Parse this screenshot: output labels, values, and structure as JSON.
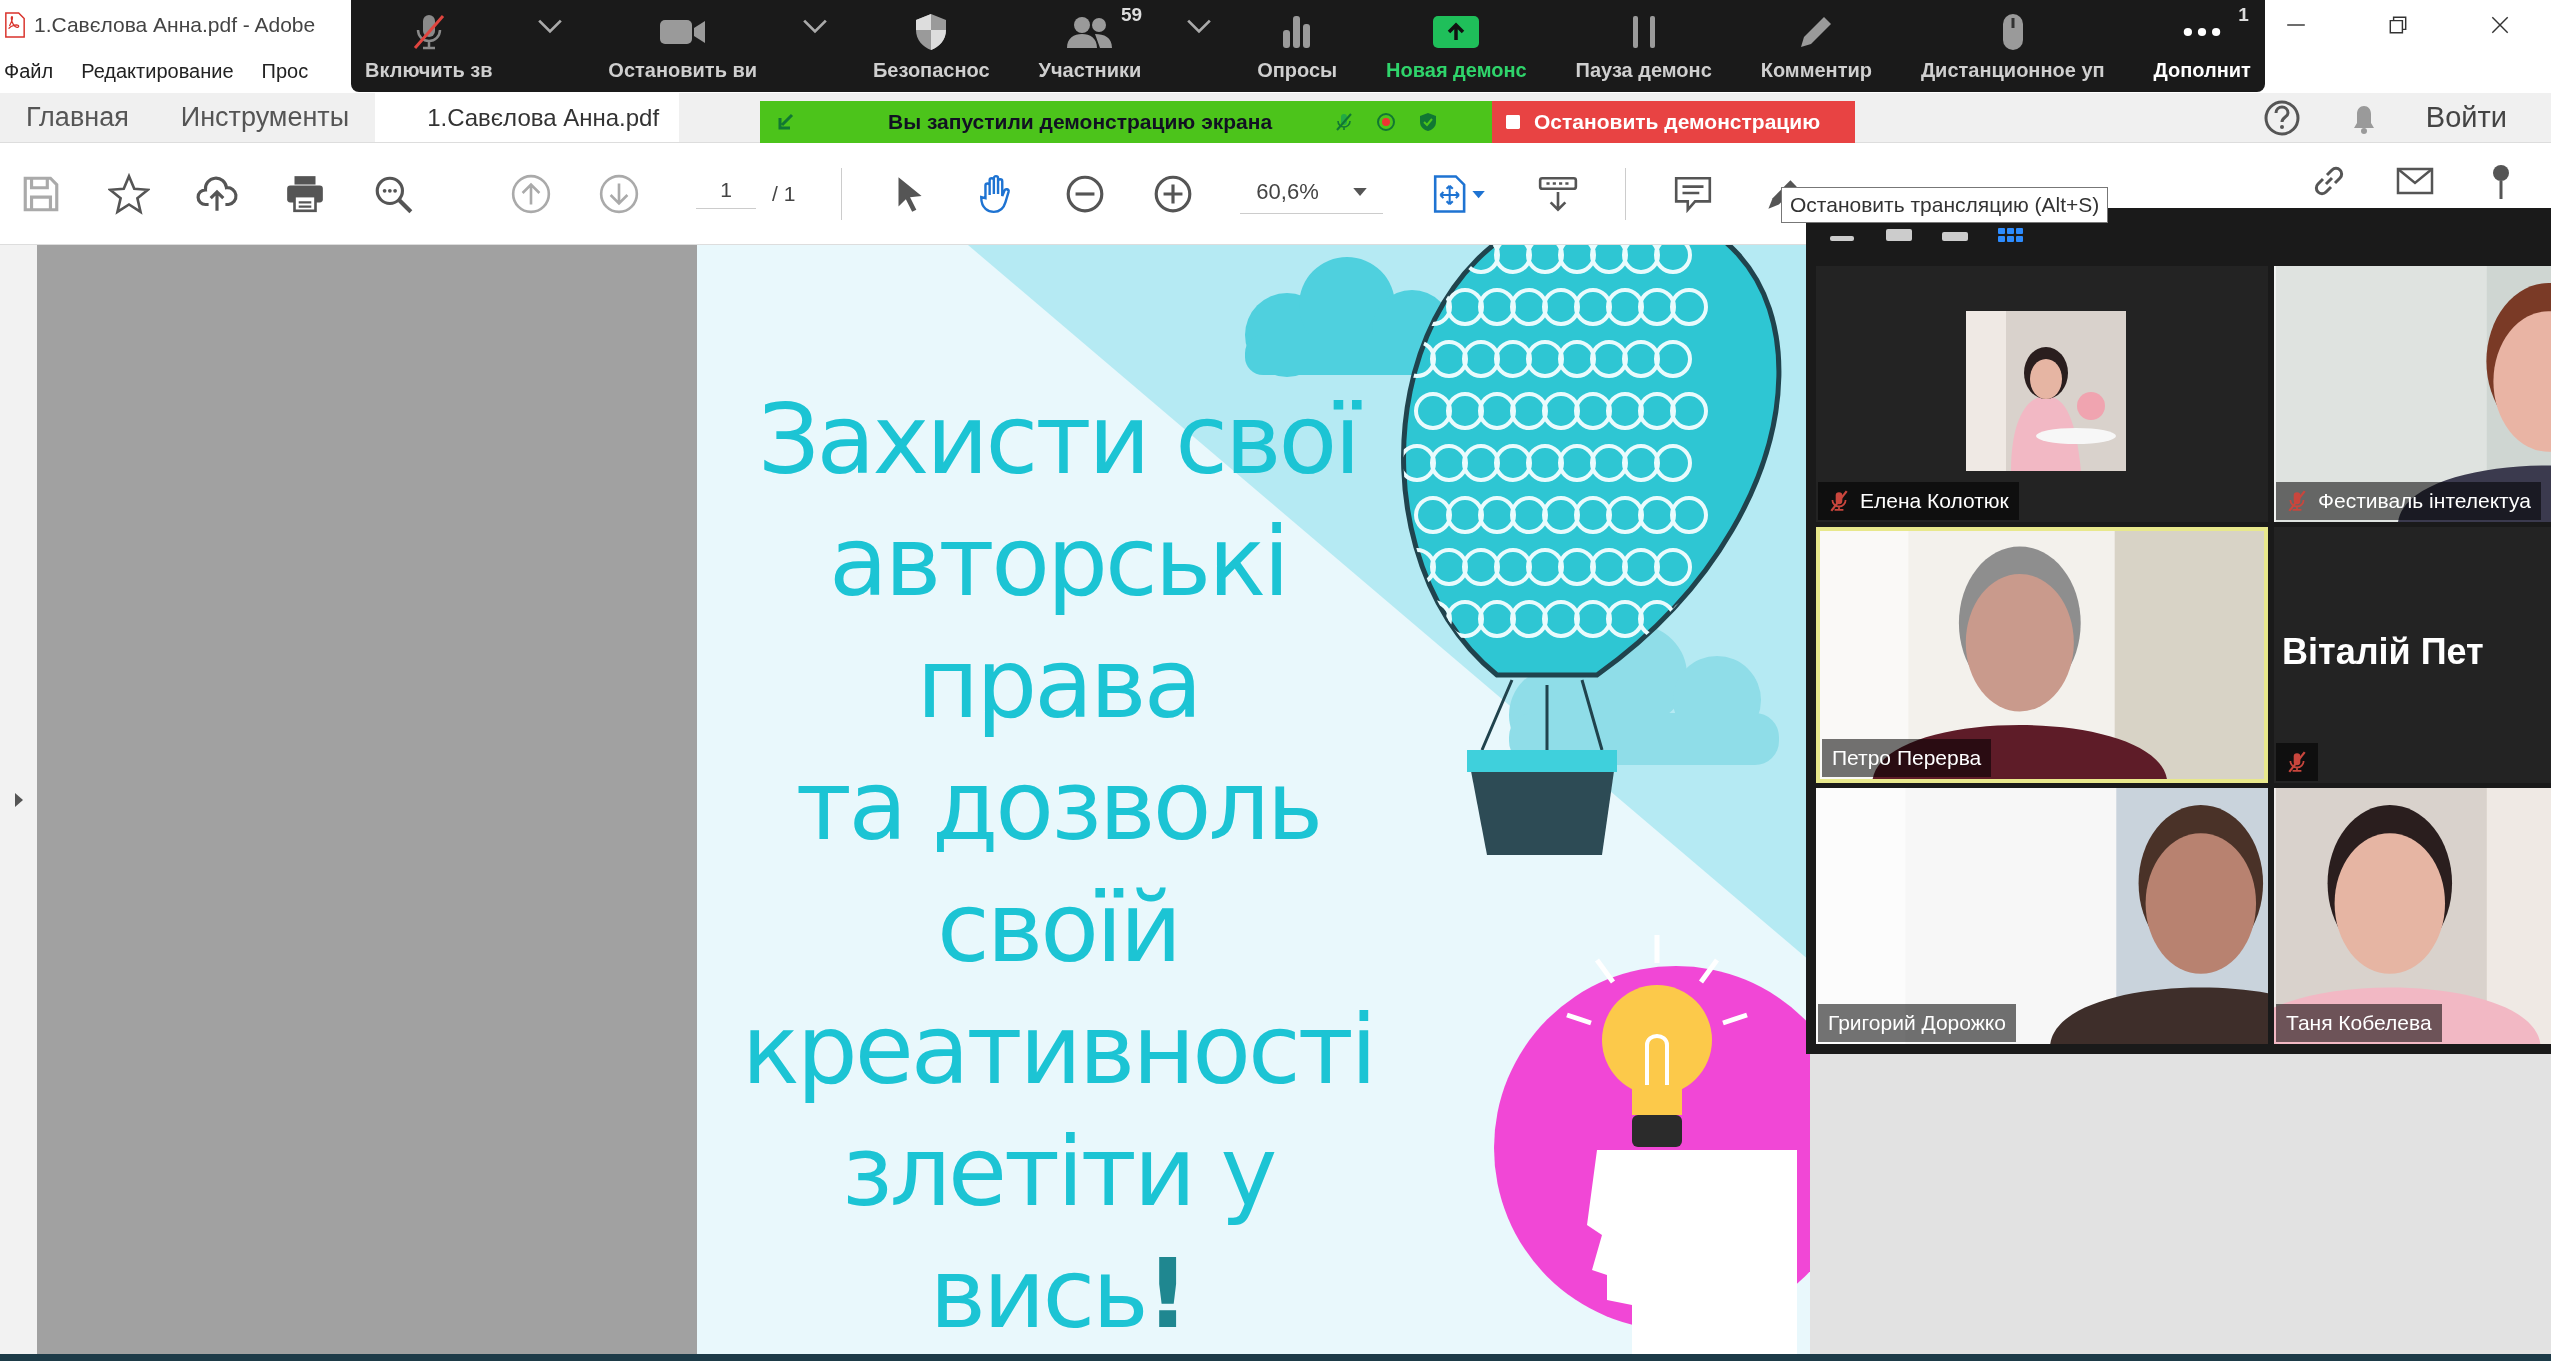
{
  "window": {
    "title": "1.Савєлова Анна.pdf - Adobe"
  },
  "menu": [
    "Файл",
    "Редактирование",
    "Прос"
  ],
  "tabs": [
    {
      "label": "Главная",
      "selected": false
    },
    {
      "label": "Инструменты",
      "selected": false
    },
    {
      "label": "1.Савєлова Анна.pdf",
      "selected": true
    }
  ],
  "header": {
    "sign_in": "Войти"
  },
  "toolbar": {
    "page": "1",
    "page_total": "/ 1",
    "zoom": "60,6%"
  },
  "document": {
    "lines": [
      "Захисти свої",
      "авторські",
      "права",
      "та дозволь",
      "своїй",
      "креативності",
      "злетіти у"
    ],
    "last_line": {
      "text": "вись",
      "accent": "!"
    }
  },
  "zoom_controls": [
    {
      "kind": "mic",
      "label": "Включить зв",
      "muted": true,
      "menu": true
    },
    {
      "kind": "video",
      "label": "Остановить ви",
      "menu": true
    },
    {
      "kind": "security",
      "label": "Безопаснос",
      "menu": false
    },
    {
      "kind": "participants",
      "label": "Участники",
      "badge": "59",
      "menu": true
    },
    {
      "kind": "polls",
      "label": "Опросы",
      "menu": false
    },
    {
      "kind": "share",
      "label": "Новая демонс",
      "menu": false
    },
    {
      "kind": "pause",
      "label": "Пауза демонс",
      "menu": false
    },
    {
      "kind": "annotate",
      "label": "Комментир",
      "menu": false
    },
    {
      "kind": "remote",
      "label": "Дистанционное уп",
      "menu": false
    },
    {
      "kind": "more",
      "label": "Дополнит",
      "badge": "1",
      "menu": false
    }
  ],
  "share_banner": {
    "message": "Вы запустили демонстрацию экрана",
    "stop": "Остановить демонстрацию"
  },
  "tooltip": "Остановить трансляцию (Alt+S)",
  "gallery": {
    "tiles": [
      {
        "name": "Елена Колотюк",
        "kind": "avatar",
        "muted": true,
        "speaking": false
      },
      {
        "name": "Фестиваль інтелектуа",
        "kind": "video",
        "muted": true,
        "speaking": false
      },
      {
        "name": "Петро Перерва",
        "kind": "video",
        "muted": false,
        "speaking": true
      },
      {
        "name": "Віталій Пет",
        "kind": "name",
        "muted": true,
        "speaking": false
      },
      {
        "name": "Григорий Дорожко",
        "kind": "video",
        "muted": false,
        "speaking": false
      },
      {
        "name": "Таня Кобелева",
        "kind": "video",
        "muted": false,
        "speaking": false
      }
    ]
  }
}
